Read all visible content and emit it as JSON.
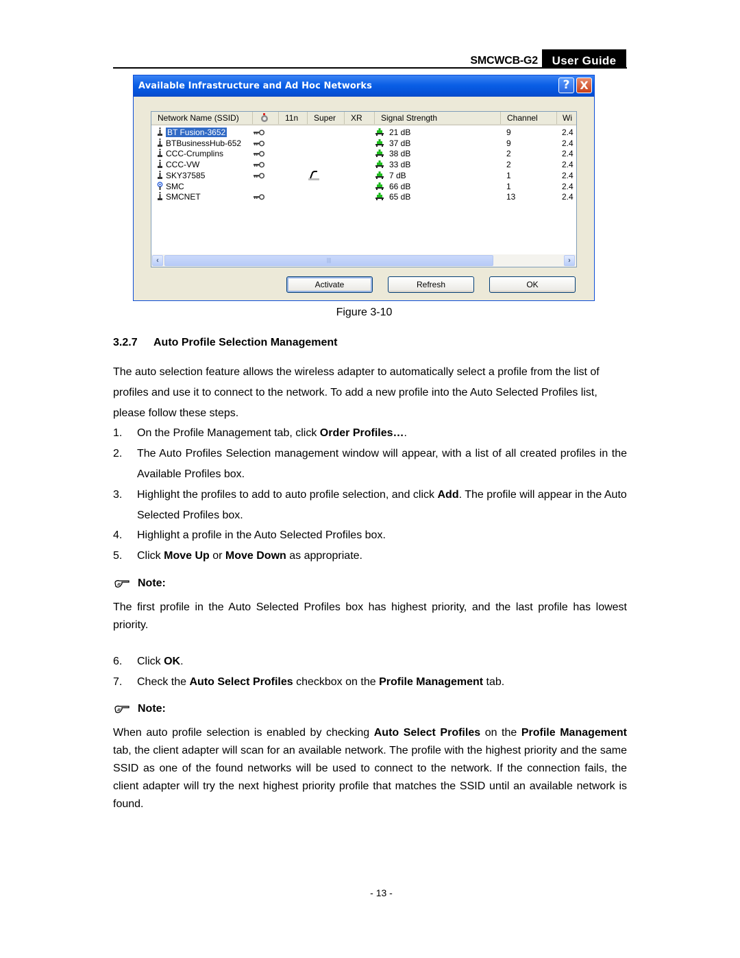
{
  "header": {
    "model": "SMCWCB-G2",
    "guide": "User Guide"
  },
  "dialog": {
    "title": "Available Infrastructure and Ad Hoc Networks",
    "help_icon": "?",
    "close_icon": "X",
    "columns": [
      "Network Name (SSID)",
      "",
      "11n",
      "Super",
      "XR",
      "Signal Strength",
      "Channel",
      "Wi"
    ],
    "rows": [
      {
        "icon": "infrastructure-antenna-icon",
        "ssid": "BT Fusion-3652",
        "selected": true,
        "encrypted": true,
        "xr": false,
        "signal": "21 dB",
        "channel": "9",
        "wireless_mode": "2.4"
      },
      {
        "icon": "infrastructure-antenna-icon",
        "ssid": "BTBusinessHub-652",
        "selected": false,
        "encrypted": true,
        "xr": false,
        "signal": "37 dB",
        "channel": "9",
        "wireless_mode": "2.4"
      },
      {
        "icon": "infrastructure-antenna-icon",
        "ssid": "CCC-Crumplins",
        "selected": false,
        "encrypted": true,
        "xr": false,
        "signal": "38 dB",
        "channel": "2",
        "wireless_mode": "2.4"
      },
      {
        "icon": "infrastructure-antenna-icon",
        "ssid": "CCC-VW",
        "selected": false,
        "encrypted": true,
        "xr": false,
        "signal": "33 dB",
        "channel": "2",
        "wireless_mode": "2.4"
      },
      {
        "icon": "infrastructure-antenna-icon",
        "ssid": "SKY37585",
        "selected": false,
        "encrypted": true,
        "xr": true,
        "signal": "7 dB",
        "channel": "1",
        "wireless_mode": "2.4"
      },
      {
        "icon": "adhoc-antenna-icon",
        "ssid": "SMC",
        "selected": false,
        "encrypted": false,
        "xr": false,
        "signal": "66 dB",
        "channel": "1",
        "wireless_mode": "2.4"
      },
      {
        "icon": "infrastructure-antenna-icon",
        "ssid": "SMCNET",
        "selected": false,
        "encrypted": true,
        "xr": false,
        "signal": "65 dB",
        "channel": "13",
        "wireless_mode": "2.4"
      }
    ],
    "buttons": {
      "activate": "Activate",
      "refresh": "Refresh",
      "ok": "OK"
    }
  },
  "caption": "Figure 3-10",
  "section": {
    "number": "3.2.7",
    "title": "Auto Profile Selection Management"
  },
  "intro": "The auto selection feature allows the wireless adapter to automatically select a profile from the list of profiles and use it to connect to the network. To add a new profile into the Auto Selected Profiles list, please follow these steps.",
  "steps_a": [
    {
      "n": "1.",
      "parts": [
        {
          "t": "On the Profile Management tab, click "
        },
        {
          "t": "Order Profiles…",
          "b": true
        },
        {
          "t": "."
        }
      ]
    },
    {
      "n": "2.",
      "parts": [
        {
          "t": "The Auto Profiles Selection management window will appear, with a list of all created profiles in the Available Profiles box."
        }
      ]
    },
    {
      "n": "3.",
      "parts": [
        {
          "t": "Highlight the profiles to add to auto profile selection, and click "
        },
        {
          "t": "Add",
          "b": true
        },
        {
          "t": ". The profile will appear in the Auto Selected Profiles box."
        }
      ]
    },
    {
      "n": "4.",
      "parts": [
        {
          "t": "Highlight a profile in the Auto Selected Profiles box."
        }
      ]
    },
    {
      "n": "5.",
      "parts": [
        {
          "t": "Click "
        },
        {
          "t": "Move Up",
          "b": true
        },
        {
          "t": " or "
        },
        {
          "t": "Move Down",
          "b": true
        },
        {
          "t": " as appropriate."
        }
      ]
    }
  ],
  "note1": {
    "label": "Note:",
    "text": "The first profile in the Auto Selected Profiles box has highest priority, and the last profile has lowest priority."
  },
  "steps_b": [
    {
      "n": "6.",
      "parts": [
        {
          "t": "Click "
        },
        {
          "t": "OK",
          "b": true
        },
        {
          "t": "."
        }
      ]
    },
    {
      "n": "7.",
      "parts": [
        {
          "t": "Check the "
        },
        {
          "t": "Auto Select Profiles",
          "b": true
        },
        {
          "t": " checkbox on the "
        },
        {
          "t": "Profile Management",
          "b": true
        },
        {
          "t": " tab."
        }
      ]
    }
  ],
  "note2": {
    "label": "Note:",
    "parts": [
      {
        "t": "When auto profile selection is enabled by checking "
      },
      {
        "t": "Auto Select Profiles",
        "b": true
      },
      {
        "t": " on the "
      },
      {
        "t": "Profile Management",
        "b": true
      },
      {
        "t": " tab, the client adapter will scan for an available network. The profile with the highest priority and the same SSID as one of the found networks will be used to connect to the network. If the connection fails, the client adapter will try the next highest priority profile that matches the SSID until an available network is found."
      }
    ]
  },
  "page_number": "- 13 -"
}
